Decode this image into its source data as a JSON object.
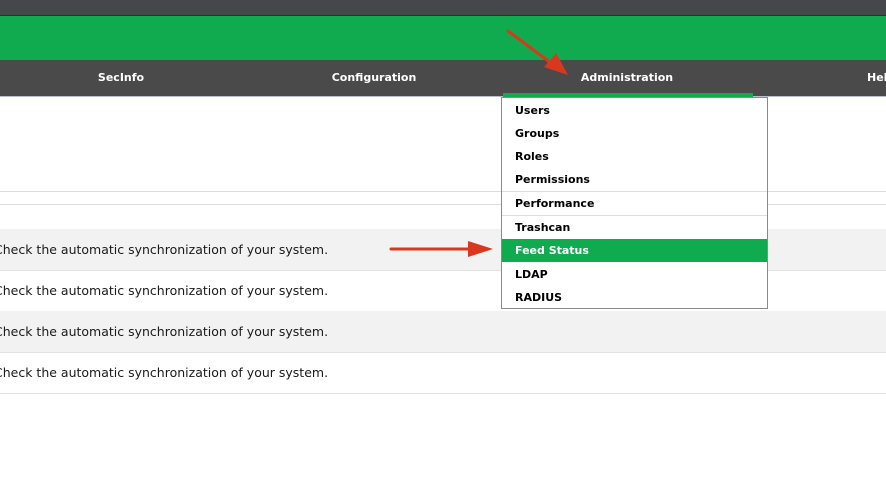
{
  "nav": {
    "items": [
      "SecInfo",
      "Configuration",
      "Administration",
      "Help"
    ]
  },
  "rows": [
    "Check the automatic synchronization of your system.",
    "Check the automatic synchronization of your system.",
    "Check the automatic synchronization of your system.",
    "Check the automatic synchronization of your system."
  ],
  "dropdown": {
    "items": [
      "Users",
      "Groups",
      "Roles",
      "Permissions",
      "Performance",
      "Trashcan",
      "Feed Status",
      "LDAP",
      "RADIUS"
    ],
    "active": "Feed Status"
  },
  "colors": {
    "brand_green": "#11ab4f",
    "nav_bg": "#4a4a4a",
    "annotation_arrow": "#d9381e"
  }
}
